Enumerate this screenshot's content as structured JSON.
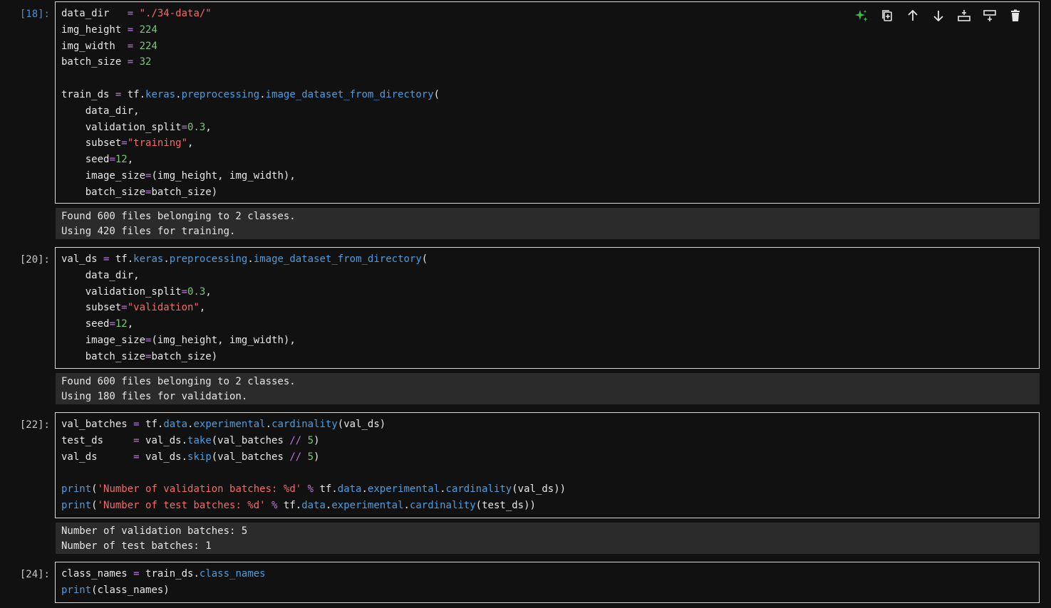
{
  "toolbar": {
    "icons": [
      "sparkle-icon",
      "duplicate-icon",
      "move-up-icon",
      "move-down-icon",
      "insert-above-icon",
      "insert-below-icon",
      "delete-icon"
    ],
    "accent": "#3fb950"
  },
  "cells": [
    {
      "prompt": "[18]:",
      "code": [
        [
          [
            "t",
            "data_dir   "
          ],
          [
            "o",
            "="
          ],
          [
            "t",
            " "
          ],
          [
            "s",
            "\"./34-data/\""
          ]
        ],
        [
          [
            "t",
            "img_height "
          ],
          [
            "o",
            "="
          ],
          [
            "t",
            " "
          ],
          [
            "n",
            "224"
          ]
        ],
        [
          [
            "t",
            "img_width  "
          ],
          [
            "o",
            "="
          ],
          [
            "t",
            " "
          ],
          [
            "n",
            "224"
          ]
        ],
        [
          [
            "t",
            "batch_size "
          ],
          [
            "o",
            "="
          ],
          [
            "t",
            " "
          ],
          [
            "n",
            "32"
          ]
        ],
        [],
        [
          [
            "t",
            "train_ds "
          ],
          [
            "o",
            "="
          ],
          [
            "t",
            " tf."
          ],
          [
            "a",
            "keras"
          ],
          [
            "t",
            "."
          ],
          [
            "a",
            "preprocessing"
          ],
          [
            "t",
            "."
          ],
          [
            "a",
            "image_dataset_from_directory"
          ],
          [
            "t",
            "("
          ]
        ],
        [
          [
            "t",
            "    data_dir,"
          ]
        ],
        [
          [
            "t",
            "    validation_split"
          ],
          [
            "o",
            "="
          ],
          [
            "n",
            "0.3"
          ],
          [
            "t",
            ","
          ]
        ],
        [
          [
            "t",
            "    subset"
          ],
          [
            "o",
            "="
          ],
          [
            "s",
            "\"training\""
          ],
          [
            "t",
            ","
          ]
        ],
        [
          [
            "t",
            "    seed"
          ],
          [
            "o",
            "="
          ],
          [
            "n",
            "12"
          ],
          [
            "t",
            ","
          ]
        ],
        [
          [
            "t",
            "    image_size"
          ],
          [
            "o",
            "="
          ],
          [
            "t",
            "(img_height, img_width),"
          ]
        ],
        [
          [
            "t",
            "    batch_size"
          ],
          [
            "o",
            "="
          ],
          [
            "t",
            "batch_size)"
          ]
        ]
      ],
      "output": [
        "Found 600 files belonging to 2 classes.",
        "Using 420 files for training."
      ]
    },
    {
      "prompt": "[20]:",
      "code": [
        [
          [
            "t",
            "val_ds "
          ],
          [
            "o",
            "="
          ],
          [
            "t",
            " tf."
          ],
          [
            "a",
            "keras"
          ],
          [
            "t",
            "."
          ],
          [
            "a",
            "preprocessing"
          ],
          [
            "t",
            "."
          ],
          [
            "a",
            "image_dataset_from_directory"
          ],
          [
            "t",
            "("
          ]
        ],
        [
          [
            "t",
            "    data_dir,"
          ]
        ],
        [
          [
            "t",
            "    validation_split"
          ],
          [
            "o",
            "="
          ],
          [
            "n",
            "0.3"
          ],
          [
            "t",
            ","
          ]
        ],
        [
          [
            "t",
            "    subset"
          ],
          [
            "o",
            "="
          ],
          [
            "s",
            "\"validation\""
          ],
          [
            "t",
            ","
          ]
        ],
        [
          [
            "t",
            "    seed"
          ],
          [
            "o",
            "="
          ],
          [
            "n",
            "12"
          ],
          [
            "t",
            ","
          ]
        ],
        [
          [
            "t",
            "    image_size"
          ],
          [
            "o",
            "="
          ],
          [
            "t",
            "(img_height, img_width),"
          ]
        ],
        [
          [
            "t",
            "    batch_size"
          ],
          [
            "o",
            "="
          ],
          [
            "t",
            "batch_size)"
          ]
        ]
      ],
      "output": [
        "Found 600 files belonging to 2 classes.",
        "Using 180 files for validation."
      ]
    },
    {
      "prompt": "[22]:",
      "code": [
        [
          [
            "t",
            "val_batches "
          ],
          [
            "o",
            "="
          ],
          [
            "t",
            " tf."
          ],
          [
            "a",
            "data"
          ],
          [
            "t",
            "."
          ],
          [
            "a",
            "experimental"
          ],
          [
            "t",
            "."
          ],
          [
            "a",
            "cardinality"
          ],
          [
            "t",
            "(val_ds)"
          ]
        ],
        [
          [
            "t",
            "test_ds     "
          ],
          [
            "o",
            "="
          ],
          [
            "t",
            " val_ds."
          ],
          [
            "a",
            "take"
          ],
          [
            "t",
            "(val_batches "
          ],
          [
            "o",
            "//"
          ],
          [
            "t",
            " "
          ],
          [
            "n",
            "5"
          ],
          [
            "t",
            ")"
          ]
        ],
        [
          [
            "t",
            "val_ds      "
          ],
          [
            "o",
            "="
          ],
          [
            "t",
            " val_ds."
          ],
          [
            "a",
            "skip"
          ],
          [
            "t",
            "(val_batches "
          ],
          [
            "o",
            "//"
          ],
          [
            "t",
            " "
          ],
          [
            "n",
            "5"
          ],
          [
            "t",
            ")"
          ]
        ],
        [],
        [
          [
            "b",
            "print"
          ],
          [
            "t",
            "("
          ],
          [
            "s",
            "'Number of validation batches: %d'"
          ],
          [
            "t",
            " "
          ],
          [
            "o",
            "%"
          ],
          [
            "t",
            " tf."
          ],
          [
            "a",
            "data"
          ],
          [
            "t",
            "."
          ],
          [
            "a",
            "experimental"
          ],
          [
            "t",
            "."
          ],
          [
            "a",
            "cardinality"
          ],
          [
            "t",
            "(val_ds))"
          ]
        ],
        [
          [
            "b",
            "print"
          ],
          [
            "t",
            "("
          ],
          [
            "s",
            "'Number of test batches: %d'"
          ],
          [
            "t",
            " "
          ],
          [
            "o",
            "%"
          ],
          [
            "t",
            " tf."
          ],
          [
            "a",
            "data"
          ],
          [
            "t",
            "."
          ],
          [
            "a",
            "experimental"
          ],
          [
            "t",
            "."
          ],
          [
            "a",
            "cardinality"
          ],
          [
            "t",
            "(test_ds))"
          ]
        ]
      ],
      "output": [
        "Number of validation batches: 5",
        "Number of test batches: 1"
      ]
    },
    {
      "prompt": "[24]:",
      "code": [
        [
          [
            "t",
            "class_names "
          ],
          [
            "o",
            "="
          ],
          [
            "t",
            " train_ds."
          ],
          [
            "a",
            "class_names"
          ]
        ],
        [
          [
            "b",
            "print"
          ],
          [
            "t",
            "(class_names)"
          ]
        ]
      ],
      "output": []
    }
  ]
}
